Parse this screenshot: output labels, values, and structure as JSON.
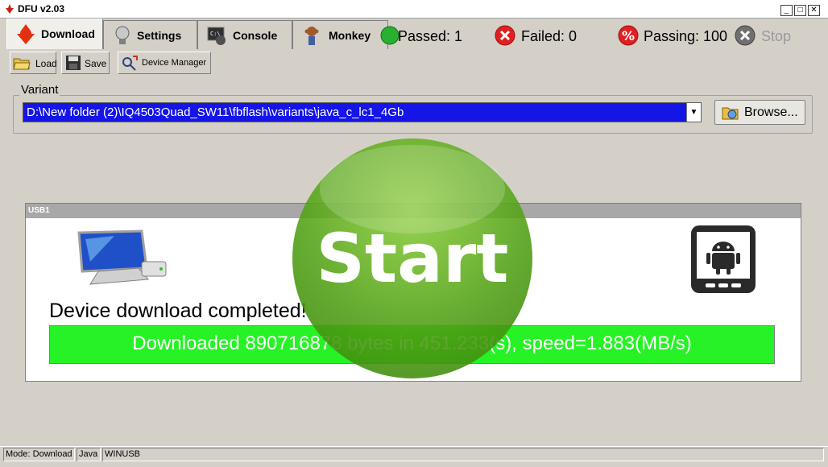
{
  "window": {
    "title": "DFU v2.03"
  },
  "tabs": [
    {
      "label": "Download",
      "icon": "download-arrow-icon"
    },
    {
      "label": "Settings",
      "icon": "bulb-icon"
    },
    {
      "label": "Console",
      "icon": "console-icon"
    },
    {
      "label": "Monkey",
      "icon": "monkey-icon"
    }
  ],
  "stats": {
    "passed": "Passed: 1",
    "failed": "Failed: 0",
    "passing": "Passing: 100",
    "stop": "Stop"
  },
  "toolbar": {
    "load": "Load",
    "save": "Save",
    "device_manager": "Device Manager"
  },
  "variant": {
    "legend": "Variant",
    "value": "D:\\New folder (2)\\IQ4503Quad_SW11\\fbflash\\variants\\java_c_lc1_4Gb",
    "browse": "Browse..."
  },
  "device": {
    "header": "USB1",
    "message": "Device download completed!",
    "progress_text": "Downloaded 890716878 bytes in 451.233(s), speed=1.883(MB/s)",
    "progress_fraction": 1.0
  },
  "start_button": "Start",
  "statusbar": [
    "Mode: Download",
    "Java",
    "WINUSB"
  ],
  "colors": {
    "accent": "#1515e8",
    "progress": "#26f226",
    "start": "#62b41c",
    "failed": "#e02020"
  }
}
